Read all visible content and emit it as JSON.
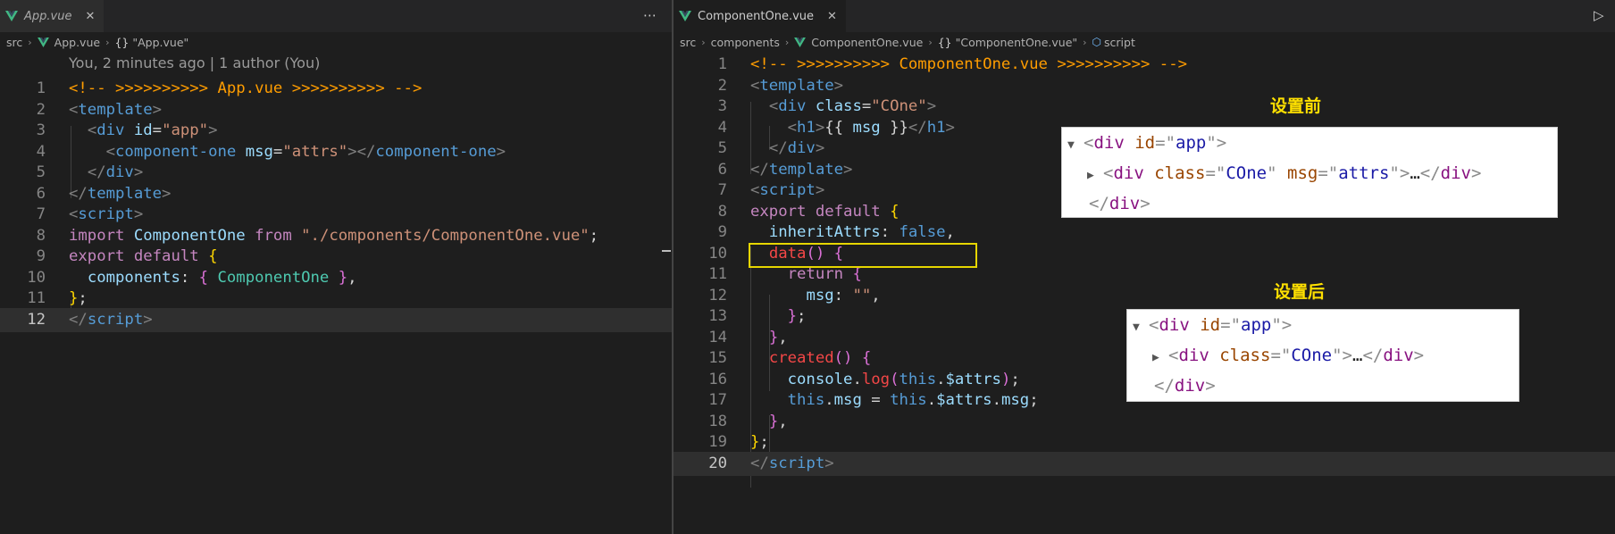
{
  "left": {
    "tab_label": "App.vue",
    "breadcrumb": {
      "src": "src",
      "file": "App.vue",
      "symbol": "\"App.vue\""
    },
    "git_lens": "You, 2 minutes ago | 1 author (You)",
    "line_numbers": [
      "1",
      "2",
      "3",
      "4",
      "5",
      "6",
      "7",
      "8",
      "9",
      "10",
      "11",
      "12"
    ],
    "lines": [
      [
        {
          "t": "<!-- >>>>>>>>>> App.vue >>>>>>>>>> -->",
          "c": "t-cmt"
        }
      ],
      [
        {
          "t": "<",
          "c": "t-punc"
        },
        {
          "t": "template",
          "c": "t-tag"
        },
        {
          "t": ">",
          "c": "t-punc"
        }
      ],
      [
        {
          "t": "  ",
          "c": "t-text"
        },
        {
          "t": "<",
          "c": "t-punc"
        },
        {
          "t": "div",
          "c": "t-tag"
        },
        {
          "t": " ",
          "c": "t-text"
        },
        {
          "t": "id",
          "c": "t-attr"
        },
        {
          "t": "=",
          "c": "t-text"
        },
        {
          "t": "\"app\"",
          "c": "t-str"
        },
        {
          "t": ">",
          "c": "t-punc"
        }
      ],
      [
        {
          "t": "    ",
          "c": "t-text"
        },
        {
          "t": "<",
          "c": "t-punc"
        },
        {
          "t": "component-one",
          "c": "t-tag"
        },
        {
          "t": " ",
          "c": "t-text"
        },
        {
          "t": "msg",
          "c": "t-attr"
        },
        {
          "t": "=",
          "c": "t-text"
        },
        {
          "t": "\"attrs\"",
          "c": "t-str"
        },
        {
          "t": "></",
          "c": "t-punc"
        },
        {
          "t": "component-one",
          "c": "t-tag"
        },
        {
          "t": ">",
          "c": "t-punc"
        }
      ],
      [
        {
          "t": "  ",
          "c": "t-text"
        },
        {
          "t": "</",
          "c": "t-punc"
        },
        {
          "t": "div",
          "c": "t-tag"
        },
        {
          "t": ">",
          "c": "t-punc"
        }
      ],
      [
        {
          "t": "</",
          "c": "t-punc"
        },
        {
          "t": "template",
          "c": "t-tag"
        },
        {
          "t": ">",
          "c": "t-punc"
        }
      ],
      [
        {
          "t": "<",
          "c": "t-punc"
        },
        {
          "t": "script",
          "c": "t-tag"
        },
        {
          "t": ">",
          "c": "t-punc"
        }
      ],
      [
        {
          "t": "import",
          "c": "t-kw"
        },
        {
          "t": " ",
          "c": "t-text"
        },
        {
          "t": "ComponentOne",
          "c": "t-var"
        },
        {
          "t": " ",
          "c": "t-text"
        },
        {
          "t": "from",
          "c": "t-kw"
        },
        {
          "t": " ",
          "c": "t-text"
        },
        {
          "t": "\"./components/ComponentOne.vue\"",
          "c": "t-str"
        },
        {
          "t": ";",
          "c": "t-text"
        }
      ],
      [
        {
          "t": "export",
          "c": "t-kw"
        },
        {
          "t": " ",
          "c": "t-text"
        },
        {
          "t": "default",
          "c": "t-kw"
        },
        {
          "t": " ",
          "c": "t-text"
        },
        {
          "t": "{",
          "c": "t-b1"
        }
      ],
      [
        {
          "t": "  ",
          "c": "t-text"
        },
        {
          "t": "components",
          "c": "t-var"
        },
        {
          "t": ": ",
          "c": "t-text"
        },
        {
          "t": "{",
          "c": "t-b2"
        },
        {
          "t": " ",
          "c": "t-text"
        },
        {
          "t": "ComponentOne",
          "c": "t-cls"
        },
        {
          "t": " ",
          "c": "t-text"
        },
        {
          "t": "}",
          "c": "t-b2"
        },
        {
          "t": ",",
          "c": "t-text"
        }
      ],
      [
        {
          "t": "}",
          "c": "t-b1"
        },
        {
          "t": ";",
          "c": "t-text"
        }
      ],
      [
        {
          "t": "</",
          "c": "t-punc"
        },
        {
          "t": "script",
          "c": "t-tag"
        },
        {
          "t": ">",
          "c": "t-punc"
        }
      ]
    ]
  },
  "right": {
    "tab_label": "ComponentOne.vue",
    "breadcrumb": {
      "src": "src",
      "folder": "components",
      "file": "ComponentOne.vue",
      "symbol": "\"ComponentOne.vue\"",
      "section": "script"
    },
    "line_numbers": [
      "1",
      "2",
      "3",
      "4",
      "5",
      "6",
      "7",
      "8",
      "9",
      "10",
      "11",
      "12",
      "13",
      "14",
      "15",
      "16",
      "17",
      "18",
      "19",
      "20"
    ],
    "lines": [
      [
        {
          "t": "<!-- >>>>>>>>>> ComponentOne.vue >>>>>>>>>> -->",
          "c": "t-cmt"
        }
      ],
      [
        {
          "t": "<",
          "c": "t-punc"
        },
        {
          "t": "template",
          "c": "t-tag"
        },
        {
          "t": ">",
          "c": "t-punc"
        }
      ],
      [
        {
          "t": "  ",
          "c": "t-text"
        },
        {
          "t": "<",
          "c": "t-punc"
        },
        {
          "t": "div",
          "c": "t-tag"
        },
        {
          "t": " ",
          "c": "t-text"
        },
        {
          "t": "class",
          "c": "t-attr"
        },
        {
          "t": "=",
          "c": "t-text"
        },
        {
          "t": "\"COne\"",
          "c": "t-str"
        },
        {
          "t": ">",
          "c": "t-punc"
        }
      ],
      [
        {
          "t": "    ",
          "c": "t-text"
        },
        {
          "t": "<",
          "c": "t-punc"
        },
        {
          "t": "h1",
          "c": "t-tag"
        },
        {
          "t": ">",
          "c": "t-punc"
        },
        {
          "t": "{{ ",
          "c": "t-text"
        },
        {
          "t": "msg",
          "c": "t-var"
        },
        {
          "t": " }}",
          "c": "t-text"
        },
        {
          "t": "</",
          "c": "t-punc"
        },
        {
          "t": "h1",
          "c": "t-tag"
        },
        {
          "t": ">",
          "c": "t-punc"
        }
      ],
      [
        {
          "t": "  ",
          "c": "t-text"
        },
        {
          "t": "</",
          "c": "t-punc"
        },
        {
          "t": "div",
          "c": "t-tag"
        },
        {
          "t": ">",
          "c": "t-punc"
        }
      ],
      [
        {
          "t": "</",
          "c": "t-punc"
        },
        {
          "t": "template",
          "c": "t-tag"
        },
        {
          "t": ">",
          "c": "t-punc"
        }
      ],
      [
        {
          "t": "<",
          "c": "t-punc"
        },
        {
          "t": "script",
          "c": "t-tag"
        },
        {
          "t": ">",
          "c": "t-punc"
        }
      ],
      [
        {
          "t": "export",
          "c": "t-kw"
        },
        {
          "t": " ",
          "c": "t-text"
        },
        {
          "t": "default",
          "c": "t-kw"
        },
        {
          "t": " ",
          "c": "t-text"
        },
        {
          "t": "{",
          "c": "t-b1"
        }
      ],
      [
        {
          "t": "  ",
          "c": "t-text"
        },
        {
          "t": "inheritAttrs",
          "c": "t-var"
        },
        {
          "t": ": ",
          "c": "t-text"
        },
        {
          "t": "false",
          "c": "t-bool"
        },
        {
          "t": ",",
          "c": "t-text"
        }
      ],
      [
        {
          "t": "  ",
          "c": "t-text"
        },
        {
          "t": "data",
          "c": "t-fnr"
        },
        {
          "t": "()",
          "c": "t-b2"
        },
        {
          "t": " ",
          "c": "t-text"
        },
        {
          "t": "{",
          "c": "t-b2"
        }
      ],
      [
        {
          "t": "    ",
          "c": "t-text"
        },
        {
          "t": "return",
          "c": "t-kw"
        },
        {
          "t": " ",
          "c": "t-text"
        },
        {
          "t": "{",
          "c": "t-b2"
        }
      ],
      [
        {
          "t": "      ",
          "c": "t-text"
        },
        {
          "t": "msg",
          "c": "t-var"
        },
        {
          "t": ": ",
          "c": "t-text"
        },
        {
          "t": "\"\"",
          "c": "t-str"
        },
        {
          "t": ",",
          "c": "t-text"
        }
      ],
      [
        {
          "t": "    ",
          "c": "t-text"
        },
        {
          "t": "}",
          "c": "t-b2"
        },
        {
          "t": ";",
          "c": "t-text"
        }
      ],
      [
        {
          "t": "  ",
          "c": "t-text"
        },
        {
          "t": "}",
          "c": "t-b2"
        },
        {
          "t": ",",
          "c": "t-text"
        }
      ],
      [
        {
          "t": "  ",
          "c": "t-text"
        },
        {
          "t": "created",
          "c": "t-fnr"
        },
        {
          "t": "()",
          "c": "t-b2"
        },
        {
          "t": " ",
          "c": "t-text"
        },
        {
          "t": "{",
          "c": "t-b2"
        }
      ],
      [
        {
          "t": "    ",
          "c": "t-text"
        },
        {
          "t": "console",
          "c": "t-var"
        },
        {
          "t": ".",
          "c": "t-text"
        },
        {
          "t": "log",
          "c": "t-fnr"
        },
        {
          "t": "(",
          "c": "t-b2"
        },
        {
          "t": "this",
          "c": "t-bool"
        },
        {
          "t": ".",
          "c": "t-text"
        },
        {
          "t": "$attrs",
          "c": "t-var"
        },
        {
          "t": ")",
          "c": "t-b2"
        },
        {
          "t": ";",
          "c": "t-text"
        }
      ],
      [
        {
          "t": "    ",
          "c": "t-text"
        },
        {
          "t": "this",
          "c": "t-bool"
        },
        {
          "t": ".",
          "c": "t-text"
        },
        {
          "t": "msg",
          "c": "t-var"
        },
        {
          "t": " = ",
          "c": "t-text"
        },
        {
          "t": "this",
          "c": "t-bool"
        },
        {
          "t": ".",
          "c": "t-text"
        },
        {
          "t": "$attrs",
          "c": "t-var"
        },
        {
          "t": ".",
          "c": "t-text"
        },
        {
          "t": "msg",
          "c": "t-var"
        },
        {
          "t": ";",
          "c": "t-text"
        }
      ],
      [
        {
          "t": "  ",
          "c": "t-text"
        },
        {
          "t": "}",
          "c": "t-b2"
        },
        {
          "t": ",",
          "c": "t-text"
        }
      ],
      [
        {
          "t": "}",
          "c": "t-b1"
        },
        {
          "t": ";",
          "c": "t-text"
        }
      ],
      [
        {
          "t": "</",
          "c": "t-punc"
        },
        {
          "t": "script",
          "c": "t-tag"
        },
        {
          "t": ">",
          "c": "t-punc"
        }
      ]
    ]
  },
  "annotations": {
    "before_label": "设置前",
    "after_label": "设置后",
    "before_dom": [
      [
        {
          "t": "<",
          "c": "d-punc"
        },
        {
          "t": "div",
          "c": "d-tag"
        },
        {
          "t": " ",
          "c": "d-ell"
        },
        {
          "t": "id",
          "c": "d-attr"
        },
        {
          "t": "=\"",
          "c": "d-punc"
        },
        {
          "t": "app",
          "c": "d-val"
        },
        {
          "t": "\">",
          "c": "d-punc"
        }
      ],
      [
        {
          "t": "<",
          "c": "d-punc"
        },
        {
          "t": "div",
          "c": "d-tag"
        },
        {
          "t": " ",
          "c": "d-ell"
        },
        {
          "t": "class",
          "c": "d-attr"
        },
        {
          "t": "=\"",
          "c": "d-punc"
        },
        {
          "t": "COne",
          "c": "d-val"
        },
        {
          "t": "\"",
          "c": "d-punc"
        },
        {
          "t": " ",
          "c": "d-ell"
        },
        {
          "t": "msg",
          "c": "d-attr"
        },
        {
          "t": "=\"",
          "c": "d-punc"
        },
        {
          "t": "attrs",
          "c": "d-val"
        },
        {
          "t": "\">",
          "c": "d-punc"
        },
        {
          "t": "…",
          "c": "d-ell"
        },
        {
          "t": "</",
          "c": "d-punc"
        },
        {
          "t": "div",
          "c": "d-tag"
        },
        {
          "t": ">",
          "c": "d-punc"
        }
      ],
      [
        {
          "t": "</",
          "c": "d-punc"
        },
        {
          "t": "div",
          "c": "d-tag"
        },
        {
          "t": ">",
          "c": "d-punc"
        }
      ]
    ],
    "after_dom": [
      [
        {
          "t": "<",
          "c": "d-punc"
        },
        {
          "t": "div",
          "c": "d-tag"
        },
        {
          "t": " ",
          "c": "d-ell"
        },
        {
          "t": "id",
          "c": "d-attr"
        },
        {
          "t": "=\"",
          "c": "d-punc"
        },
        {
          "t": "app",
          "c": "d-val"
        },
        {
          "t": "\">",
          "c": "d-punc"
        }
      ],
      [
        {
          "t": "<",
          "c": "d-punc"
        },
        {
          "t": "div",
          "c": "d-tag"
        },
        {
          "t": " ",
          "c": "d-ell"
        },
        {
          "t": "class",
          "c": "d-attr"
        },
        {
          "t": "=\"",
          "c": "d-punc"
        },
        {
          "t": "COne",
          "c": "d-val"
        },
        {
          "t": "\">",
          "c": "d-punc"
        },
        {
          "t": "…",
          "c": "d-ell"
        },
        {
          "t": "</",
          "c": "d-punc"
        },
        {
          "t": "div",
          "c": "d-tag"
        },
        {
          "t": ">",
          "c": "d-punc"
        }
      ],
      [
        {
          "t": "</",
          "c": "d-punc"
        },
        {
          "t": "div",
          "c": "d-tag"
        },
        {
          "t": ">",
          "c": "d-punc"
        }
      ]
    ]
  },
  "icons": {
    "more": "more-actions-icon",
    "run": "run-icon",
    "close": "close-icon",
    "vue": "vue-file-icon"
  },
  "colors": {
    "editor_bg": "#1e1e1e",
    "comment": "#ff9d00",
    "highlight_box": "#e6d600",
    "annotation_label": "#ffe000"
  }
}
